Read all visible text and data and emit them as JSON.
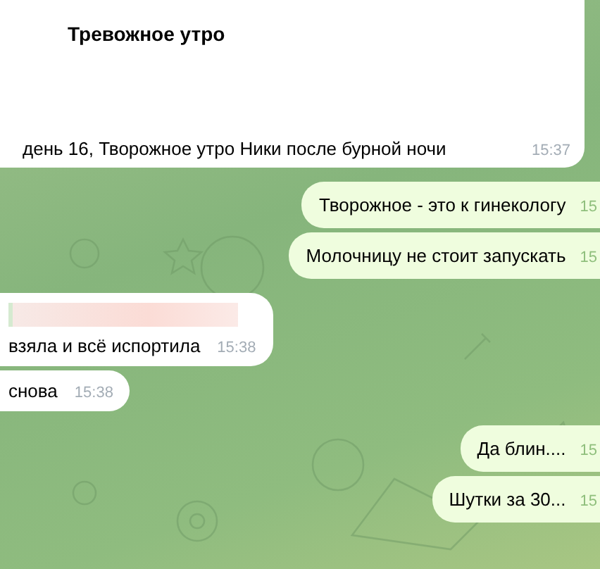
{
  "messages": [
    {
      "kind": "card",
      "title": "Тревожное утро",
      "text": "день 16, Творожное утро Ники после бурной ночи",
      "time": "15:37"
    },
    {
      "kind": "outgoing",
      "text": "Творожное - это к гинекологу",
      "time": "15"
    },
    {
      "kind": "outgoing",
      "text": "Молочницу не стоит запускать",
      "time": "15"
    },
    {
      "kind": "reply",
      "text": "взяла и всё испортила",
      "time": "15:38"
    },
    {
      "kind": "incoming",
      "text": "снова",
      "time": "15:38"
    },
    {
      "kind": "outgoing",
      "text": "Да блин....",
      "time": "15"
    },
    {
      "kind": "outgoing",
      "text": "Шутки за 30...",
      "time": "15"
    }
  ]
}
